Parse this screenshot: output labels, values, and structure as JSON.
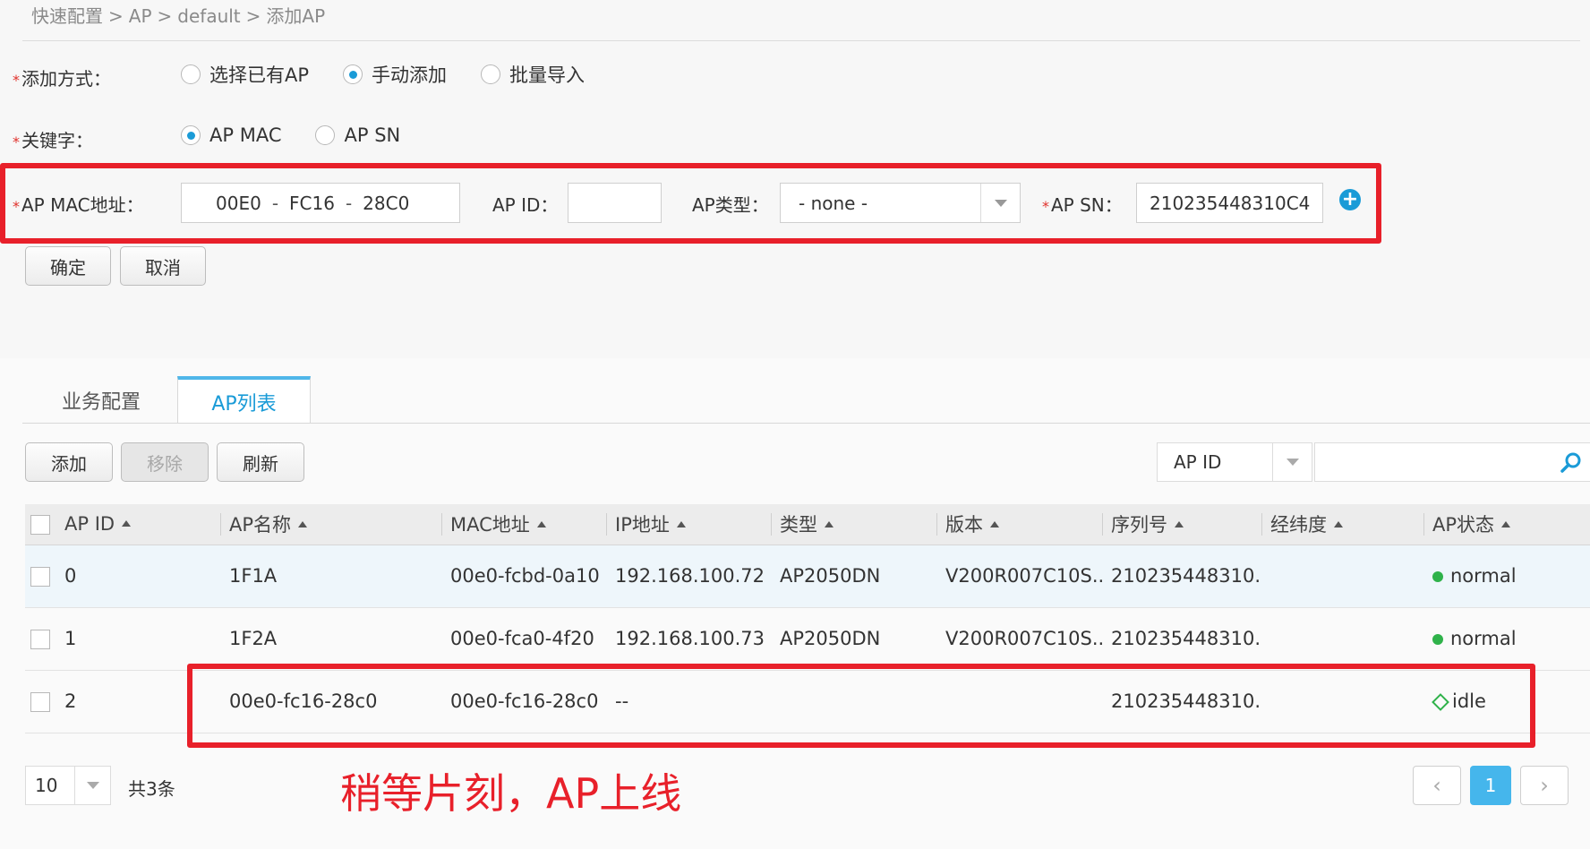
{
  "breadcrumb": [
    "快速配置",
    "AP",
    "default",
    "添加AP"
  ],
  "breadcrumb_sep": ">",
  "form": {
    "add_mode_label": "添加方式：",
    "add_mode_options": [
      "选择已有AP",
      "手动添加",
      "批量导入"
    ],
    "add_mode_selected": "手动添加",
    "keyword_label": "关键字：",
    "keyword_options": [
      "AP MAC",
      "AP SN"
    ],
    "keyword_selected": "AP MAC",
    "mac_label": "AP MAC地址：",
    "mac_segments": [
      "00E0",
      "FC16",
      "28C0"
    ],
    "mac_sep": "-",
    "ap_id_label": "AP ID：",
    "ap_id_value": "",
    "ap_type_label": "AP类型：",
    "ap_type_value": "- none -",
    "ap_sn_label": "AP SN：",
    "ap_sn_value": "210235448310C4",
    "required_mark": "*",
    "confirm_label": "确定",
    "cancel_label": "取消"
  },
  "tabs": [
    "业务配置",
    "AP列表"
  ],
  "active_tab": "AP列表",
  "toolbar": {
    "add_label": "添加",
    "remove_label": "移除",
    "refresh_label": "刷新",
    "search_field": "AP ID",
    "search_value": ""
  },
  "table": {
    "columns": [
      "AP ID",
      "AP名称",
      "MAC地址",
      "IP地址",
      "类型",
      "版本",
      "序列号",
      "经纬度",
      "AP状态"
    ],
    "rows": [
      {
        "id": "0",
        "name": "1F1A",
        "mac": "00e0-fcbd-0a10",
        "ip": "192.168.100.72",
        "type": "AP2050DN",
        "version": "V200R007C10S...",
        "serial": "210235448310...",
        "geo": "",
        "status": "normal"
      },
      {
        "id": "1",
        "name": "1F2A",
        "mac": "00e0-fca0-4f20",
        "ip": "192.168.100.73",
        "type": "AP2050DN",
        "version": "V200R007C10S...",
        "serial": "210235448310...",
        "geo": "",
        "status": "normal"
      },
      {
        "id": "2",
        "name": "00e0-fc16-28c0",
        "mac": "00e0-fc16-28c0",
        "ip": "--",
        "type": "",
        "version": "",
        "serial": "210235448310...",
        "geo": "",
        "status": "idle"
      }
    ]
  },
  "pagination": {
    "page_size": "10",
    "total_label": "共3条",
    "current_page": "1",
    "prev_icon": "‹",
    "next_icon": "›"
  },
  "annotation": "稍等片刻，AP上线",
  "colors": {
    "accent": "#1a9bd7",
    "highlight_box": "#e8202a",
    "status_normal": "#2fb24a"
  }
}
